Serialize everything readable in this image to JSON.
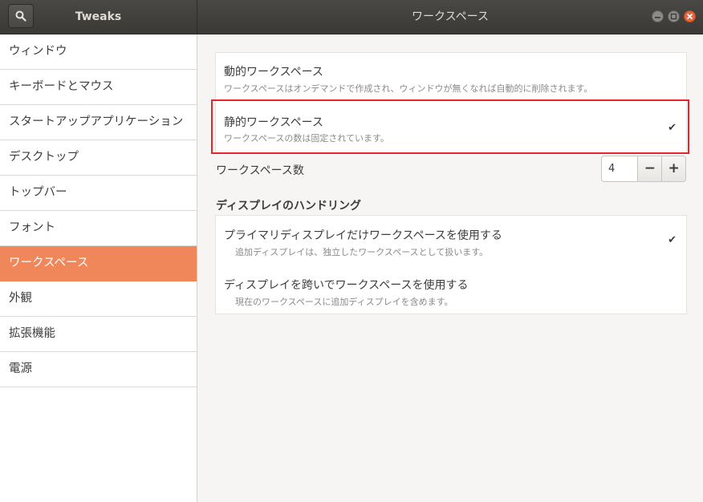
{
  "titlebar": {
    "app_title": "Tweaks",
    "window_title": "ワークスペース",
    "search_icon": "search-icon",
    "controls": [
      "minimize-icon",
      "maximize-icon",
      "close-icon"
    ]
  },
  "sidebar": {
    "items": [
      {
        "label": "ウィンドウ"
      },
      {
        "label": "キーボードとマウス"
      },
      {
        "label": "スタートアップアプリケーション"
      },
      {
        "label": "デスクトップ"
      },
      {
        "label": "トップバー"
      },
      {
        "label": "フォント"
      },
      {
        "label": "ワークスペース",
        "active": true
      },
      {
        "label": "外観"
      },
      {
        "label": "拡張機能"
      },
      {
        "label": "電源"
      }
    ]
  },
  "workspaces": {
    "dynamic": {
      "title": "動的ワークスペース",
      "subtitle": "ワークスペースはオンデマンドで作成され、ウィンドウが無くなれば自動的に削除されます。",
      "selected": false
    },
    "static": {
      "title": "静的ワークスペース",
      "subtitle": "ワークスペースの数は固定されています。",
      "selected": true,
      "check": "✔"
    },
    "count": {
      "label": "ワークスペース数",
      "value": "4",
      "minus": "−",
      "plus": "+"
    }
  },
  "display_handling": {
    "heading": "ディスプレイのハンドリング",
    "primary": {
      "title": "プライマリディスプレイだけワークスペースを使用する",
      "subtitle": "追加ディスプレイは、独立したワークスペースとして扱います。",
      "selected": true,
      "check": "✔"
    },
    "span": {
      "title": "ディスプレイを跨いでワークスペースを使用する",
      "subtitle": "現在のワークスペースに追加ディスプレイを含めます。",
      "selected": false
    }
  },
  "colors": {
    "accent": "#f0875b",
    "highlight_border": "#e3262e",
    "titlebar": "#403e3a"
  }
}
